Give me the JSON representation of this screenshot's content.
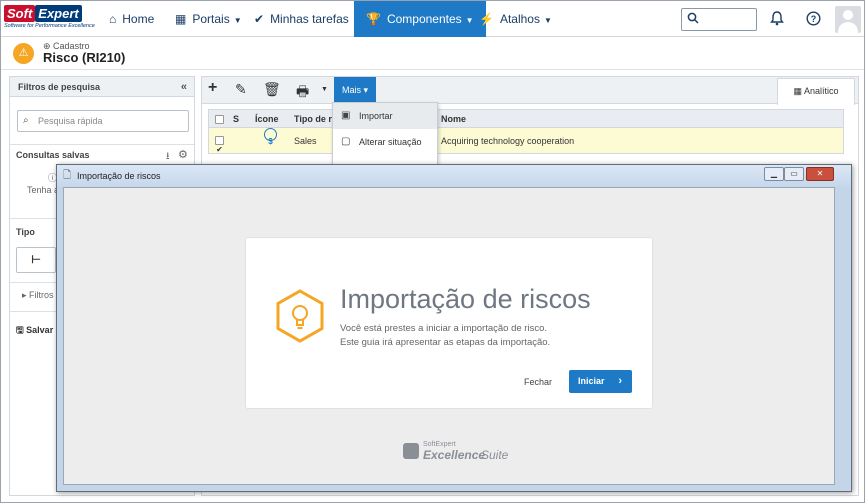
{
  "logo": {
    "part1": "Soft",
    "part2": "Expert",
    "tagline": "Software for Performance Excellence"
  },
  "nav": {
    "home": "Home",
    "portais": "Portais",
    "minhas_tarefas": "Minhas tarefas",
    "componentes": "Componentes",
    "atalhos": "Atalhos"
  },
  "header": {
    "breadcrumb": "Cadastro",
    "title": "Risco (RI210)"
  },
  "left_panel": {
    "title": "Filtros de pesquisa",
    "quick_search_placeholder": "Pesquisa rápida",
    "saved_queries": "Consultas salvas",
    "saved_hint": "Tenha a",
    "tipo_label": "Tipo",
    "filters_label": "Filtros",
    "save_label": "Salvar"
  },
  "toolbar": {
    "mais_label": "Mais",
    "analitico_label": "Analítico"
  },
  "grid": {
    "headers": {
      "s": "S",
      "icone": "Ícone",
      "tipo": "Tipo de ris",
      "nome": "Nome"
    },
    "rows": [
      {
        "tipo": "Sales",
        "nome": "Acquiring technology cooperation",
        "checked": "✔"
      }
    ]
  },
  "dropdown": {
    "items": [
      "Importar",
      "Alterar situação"
    ]
  },
  "modal": {
    "window_title": "Importação de riscos",
    "heading": "Importação de riscos",
    "line1": "Você está prestes a iniciar a importação de risco.",
    "line2": "Este guia irá apresentar as etapas da importação.",
    "close_label": "Fechar",
    "start_label": "Iniciar"
  },
  "brand": {
    "top": "SoftExpert",
    "excellence": "Excellence",
    "suite": "Suite"
  },
  "colors": {
    "accent": "#1e7ac6",
    "warning": "#f5a623",
    "row_highlight": "#fdfbd4"
  }
}
